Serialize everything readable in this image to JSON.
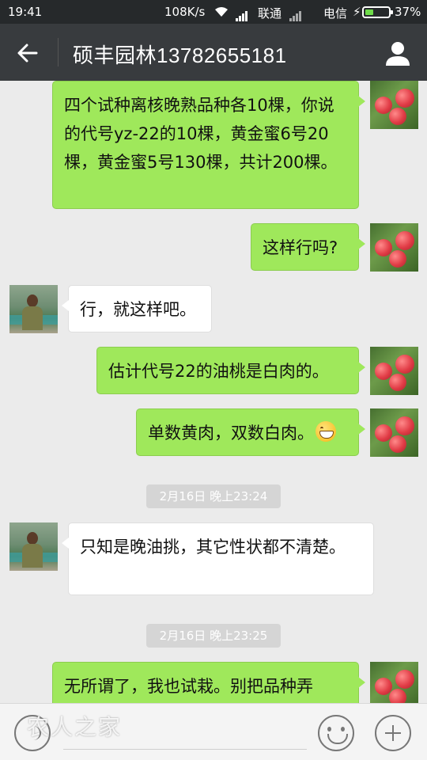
{
  "status_bar": {
    "time": "19:41",
    "speed": "108K/s",
    "carrier1": "联通",
    "carrier2": "电信",
    "battery": "37%",
    "battery_level": 0.37,
    "battery_color": "#6fdc4a"
  },
  "header": {
    "title": "硕丰园林13782655181",
    "back_icon": "arrow-left-icon",
    "profile_icon": "person-icon"
  },
  "messages": [
    {
      "sender": "me",
      "text": "四个试种离核晚熟品种各10棵，你说的代号yz-22的10棵，黄金蜜6号20棵，黄金蜜5号130棵，共计200棵。"
    },
    {
      "sender": "me",
      "text": "这样行吗?"
    },
    {
      "sender": "them",
      "text": "行，就这样吧。"
    },
    {
      "sender": "me",
      "text": "估计代号22的油桃是白肉的。"
    },
    {
      "sender": "me",
      "text": "单数黄肉，双数白肉。",
      "emoji": "grinning-face-icon"
    },
    {
      "type": "timestamp",
      "text": "2月16日 晚上23:24"
    },
    {
      "sender": "them",
      "text": "只知是晚油挑，其它性状都不清楚。"
    },
    {
      "type": "timestamp",
      "text": "2月16日 晚上23:25"
    },
    {
      "sender": "me",
      "text": "无所谓了，我也试栽。别把品种弄"
    }
  ],
  "input_bar": {
    "watermark": "农人之家",
    "voice_icon": "voice-icon",
    "emoji_icon": "smiley-icon",
    "plus_icon": "plus-icon"
  },
  "colors": {
    "my_bubble": "#9fe85b",
    "their_bubble": "#ffffff",
    "header_bg": "#383b3e",
    "chat_bg": "#ebebeb"
  }
}
